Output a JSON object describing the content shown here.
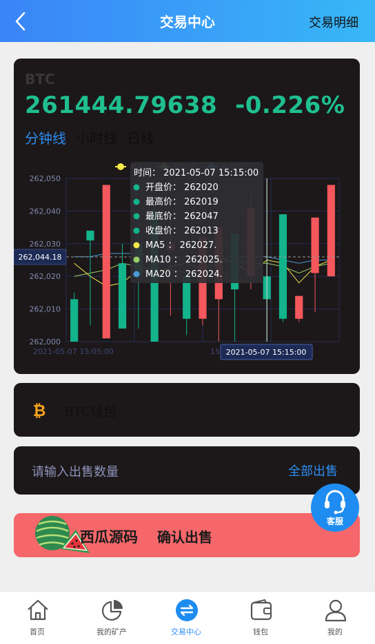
{
  "header": {
    "title": "交易中心",
    "detail_link": "交易明细"
  },
  "market": {
    "coin": "BTC",
    "price": "261444.79638",
    "change": "-0.226%",
    "tabs": [
      {
        "label": "分钟线",
        "active": true
      },
      {
        "label": "小时线",
        "active": false
      },
      {
        "label": "日线",
        "active": false
      }
    ]
  },
  "chart_data": {
    "type": "candlestick",
    "legend": [
      "MA5",
      "MA10",
      "MA20"
    ],
    "y_ticks": [
      "262,050",
      "262,040",
      "262,030",
      "262,020",
      "262,010",
      "262,000"
    ],
    "ylim": [
      262000,
      262050
    ],
    "x_ticks": [
      "2021-05-07 15:05:00",
      "15:"
    ],
    "pointer_y_label": "262,044.18",
    "pointer_x_label": "2021-05-07 15:15:00",
    "colors": {
      "up": "#f4575c",
      "down": "#13b38b",
      "ma5": "#f5e84a",
      "ma10": "#9acd68",
      "ma20": "#4a9bd4"
    },
    "candles": [
      {
        "open": 262013,
        "close": 262000,
        "high": 262015,
        "low": 262000
      },
      {
        "open": 262034,
        "close": 262031,
        "high": 262034,
        "low": 262005
      },
      {
        "open": 262001,
        "close": 262048,
        "high": 262048,
        "low": 262001
      },
      {
        "open": 262024,
        "close": 262004,
        "high": 262030,
        "low": 262004
      },
      {
        "open": 262030,
        "close": 262020,
        "high": 262040,
        "low": 262004
      },
      {
        "open": 262040,
        "close": 262000,
        "high": 262046,
        "low": 262000
      },
      {
        "open": 262028,
        "close": 262030,
        "high": 262038,
        "low": 262008
      },
      {
        "open": 262020,
        "close": 262007,
        "high": 262022,
        "low": 262002
      },
      {
        "open": 262007,
        "close": 262032,
        "high": 262032,
        "low": 262005
      },
      {
        "open": 262013,
        "close": 262035,
        "high": 262035,
        "low": 262000
      },
      {
        "open": 262033,
        "close": 262016,
        "high": 262033,
        "low": 262000
      },
      {
        "open": 262020,
        "close": 262041,
        "high": 262046,
        "low": 262016
      },
      {
        "open": 262020,
        "close": 262013,
        "high": 262050,
        "low": 262000
      },
      {
        "open": 262039,
        "close": 262007,
        "high": 262039,
        "low": 262006
      },
      {
        "open": 262007,
        "close": 262014,
        "high": 262014,
        "low": 262006
      },
      {
        "open": 262021,
        "close": 262038,
        "high": 262038,
        "low": 262009
      },
      {
        "open": 262020,
        "close": 262048,
        "high": 262048,
        "low": 262020
      }
    ],
    "ma5": [
      262024,
      262020,
      262017,
      262018,
      262022,
      262020,
      262023,
      262024,
      262022,
      262026,
      262024,
      262021,
      262025,
      262024,
      262018,
      262023,
      262025
    ],
    "ma10": [
      262020,
      262021,
      262022,
      262024,
      262023,
      262022,
      262022,
      262021,
      262022,
      262024,
      262025,
      262024,
      262024,
      262023,
      262021,
      262023,
      262024
    ],
    "ma20": [
      262026,
      262026,
      262027,
      262027,
      262027,
      262026,
      262026,
      262025,
      262025,
      262025,
      262026,
      262026,
      262026,
      262025,
      262024,
      262025,
      262025
    ],
    "tooltip": {
      "rows": [
        {
          "label": "时间：",
          "value": "2021-05-07 15:15:00",
          "color": ""
        },
        {
          "label": "开盘价：",
          "value": "262020",
          "color": "#13b38b"
        },
        {
          "label": "最高价：",
          "value": "262019",
          "color": "#13b38b"
        },
        {
          "label": "最底价：",
          "value": "262047",
          "color": "#13b38b"
        },
        {
          "label": "收盘价：",
          "value": "262013",
          "color": "#13b38b"
        },
        {
          "label": "MA5 ：",
          "value": "262027.",
          "color": "#f5e84a"
        },
        {
          "label": "MA10 ：",
          "value": "262025.",
          "color": "#9acd68"
        },
        {
          "label": "MA20 ：",
          "value": "262024.",
          "color": "#4a9bd4"
        }
      ]
    }
  },
  "wallet": {
    "label": "BTC钱包"
  },
  "sell": {
    "placeholder": "请输入出售数量",
    "sell_all": "全部出售"
  },
  "confirm": {
    "brand": "西瓜源码",
    "label": "确认出售"
  },
  "service": {
    "label": "客服"
  },
  "nav": [
    {
      "label": "首页",
      "icon": "home-icon",
      "active": false
    },
    {
      "label": "我的矿产",
      "icon": "pie-chart-icon",
      "active": false
    },
    {
      "label": "交易中心",
      "icon": "exchange-icon",
      "active": true
    },
    {
      "label": "钱包",
      "icon": "wallet-icon",
      "active": false
    },
    {
      "label": "我的",
      "icon": "user-icon",
      "active": false
    }
  ]
}
